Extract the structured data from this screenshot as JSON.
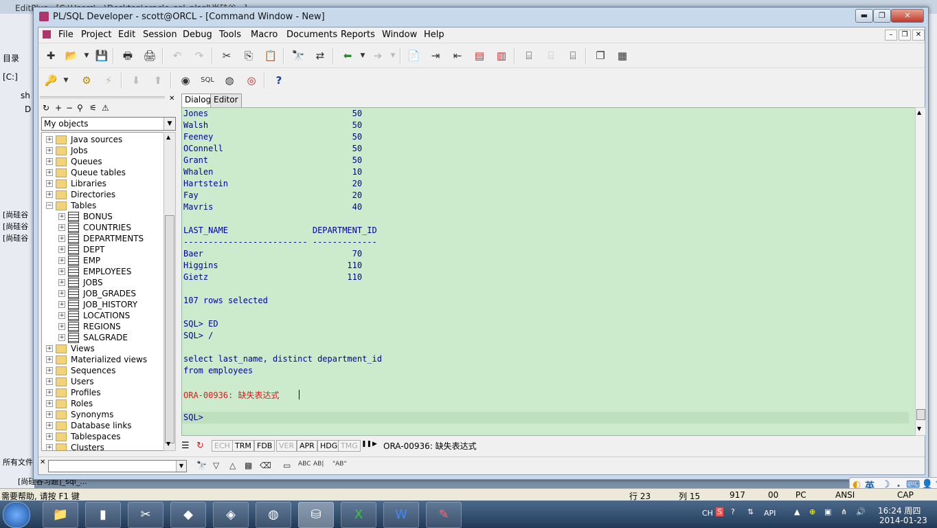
{
  "background_app": {
    "title": "EditPlus - [C:\\Users\\...\\Desktop\\oracle_sql_plsql\\尚硅谷...]",
    "left_items": [
      "目录",
      "[C:]",
      "sh",
      "D",
      "[尚硅谷",
      "[尚硅谷",
      "[尚硅谷",
      "所有文件",
      "[尚硅谷习题]_sql_..."
    ]
  },
  "window": {
    "title": "PL/SQL Developer - scott@ORCL - [Command Window - New]",
    "controls": {
      "minimize": "▬",
      "restore": "❐",
      "close": "✕"
    }
  },
  "menu": [
    "File",
    "Project",
    "Edit",
    "Session",
    "Debug",
    "Tools",
    "Macro",
    "Documents",
    "Reports",
    "Window",
    "Help"
  ],
  "object_browser": {
    "selector_value": "My objects",
    "close": "✕",
    "tree": [
      {
        "label": "Java sources",
        "kind": "folder",
        "level": 0
      },
      {
        "label": "Jobs",
        "kind": "folder",
        "level": 0
      },
      {
        "label": "Queues",
        "kind": "folder",
        "level": 0
      },
      {
        "label": "Queue tables",
        "kind": "folder",
        "level": 0
      },
      {
        "label": "Libraries",
        "kind": "folder",
        "level": 0
      },
      {
        "label": "Directories",
        "kind": "folder",
        "level": 0
      },
      {
        "label": "Tables",
        "kind": "folder",
        "level": 0,
        "expanded": true
      },
      {
        "label": "BONUS",
        "kind": "table",
        "level": 1
      },
      {
        "label": "COUNTRIES",
        "kind": "table",
        "level": 1
      },
      {
        "label": "DEPARTMENTS",
        "kind": "table",
        "level": 1
      },
      {
        "label": "DEPT",
        "kind": "table",
        "level": 1
      },
      {
        "label": "EMP",
        "kind": "table",
        "level": 1
      },
      {
        "label": "EMPLOYEES",
        "kind": "table",
        "level": 1
      },
      {
        "label": "JOBS",
        "kind": "table",
        "level": 1
      },
      {
        "label": "JOB_GRADES",
        "kind": "table",
        "level": 1
      },
      {
        "label": "JOB_HISTORY",
        "kind": "table",
        "level": 1
      },
      {
        "label": "LOCATIONS",
        "kind": "table",
        "level": 1
      },
      {
        "label": "REGIONS",
        "kind": "table",
        "level": 1
      },
      {
        "label": "SALGRADE",
        "kind": "table",
        "level": 1
      },
      {
        "label": "Views",
        "kind": "folder",
        "level": 0
      },
      {
        "label": "Materialized views",
        "kind": "folder",
        "level": 0
      },
      {
        "label": "Sequences",
        "kind": "folder",
        "level": 0
      },
      {
        "label": "Users",
        "kind": "folder",
        "level": 0
      },
      {
        "label": "Profiles",
        "kind": "folder",
        "level": 0
      },
      {
        "label": "Roles",
        "kind": "folder",
        "level": 0
      },
      {
        "label": "Synonyms",
        "kind": "folder",
        "level": 0
      },
      {
        "label": "Database links",
        "kind": "folder",
        "level": 0
      },
      {
        "label": "Tablespaces",
        "kind": "folder",
        "level": 0
      },
      {
        "label": "Clusters",
        "kind": "folder",
        "level": 0
      }
    ]
  },
  "tabs": [
    "Dialog",
    "Editor"
  ],
  "output": {
    "lines": [
      {
        "text": "Jones                             50",
        "type": "normal"
      },
      {
        "text": "Walsh                             50",
        "type": "normal"
      },
      {
        "text": "Feeney                            50",
        "type": "normal"
      },
      {
        "text": "OConnell                          50",
        "type": "normal"
      },
      {
        "text": "Grant                             50",
        "type": "normal"
      },
      {
        "text": "Whalen                            10",
        "type": "normal"
      },
      {
        "text": "Hartstein                         20",
        "type": "normal"
      },
      {
        "text": "Fay                               20",
        "type": "normal"
      },
      {
        "text": "Mavris                            40",
        "type": "normal"
      },
      {
        "text": "",
        "type": "normal"
      },
      {
        "text": "LAST_NAME                 DEPARTMENT_ID",
        "type": "normal"
      },
      {
        "text": "------------------------- -------------",
        "type": "normal"
      },
      {
        "text": "Baer                              70",
        "type": "normal"
      },
      {
        "text": "Higgins                          110",
        "type": "normal"
      },
      {
        "text": "Gietz                            110",
        "type": "normal"
      },
      {
        "text": "",
        "type": "normal"
      },
      {
        "text": "107 rows selected",
        "type": "normal"
      },
      {
        "text": "",
        "type": "normal"
      },
      {
        "text": "SQL> ED",
        "type": "normal"
      },
      {
        "text": "SQL> /",
        "type": "normal"
      },
      {
        "text": "",
        "type": "normal"
      },
      {
        "text": "select last_name, distinct department_id",
        "type": "normal"
      },
      {
        "text": "from employees",
        "type": "normal"
      },
      {
        "text": "",
        "type": "normal"
      },
      {
        "text": "ORA-00936: 缺失表达式",
        "type": "err"
      },
      {
        "text": "",
        "type": "normal"
      },
      {
        "text": "SQL>",
        "type": "normal"
      }
    ]
  },
  "toggles": [
    "ECH",
    "TRM",
    "FDB",
    "VER",
    "APR",
    "HDG",
    "TMG"
  ],
  "toggles_dim": [
    "ECH",
    "VER",
    "TMG"
  ],
  "status_message": "ORA-00936: 缺失表达式",
  "ime": {
    "label": "英"
  },
  "statusbar": {
    "help": "需要帮助, 请按 F1 键",
    "line": "行 23",
    "col": "列 15",
    "pos": "917",
    "sel": "00",
    "mode": "PC",
    "encoding": "ANSI",
    "caps": "CAP"
  },
  "tray": {
    "lang": "CH",
    "api": "API",
    "time": "16:24 周四",
    "date": "2014-01-23"
  }
}
